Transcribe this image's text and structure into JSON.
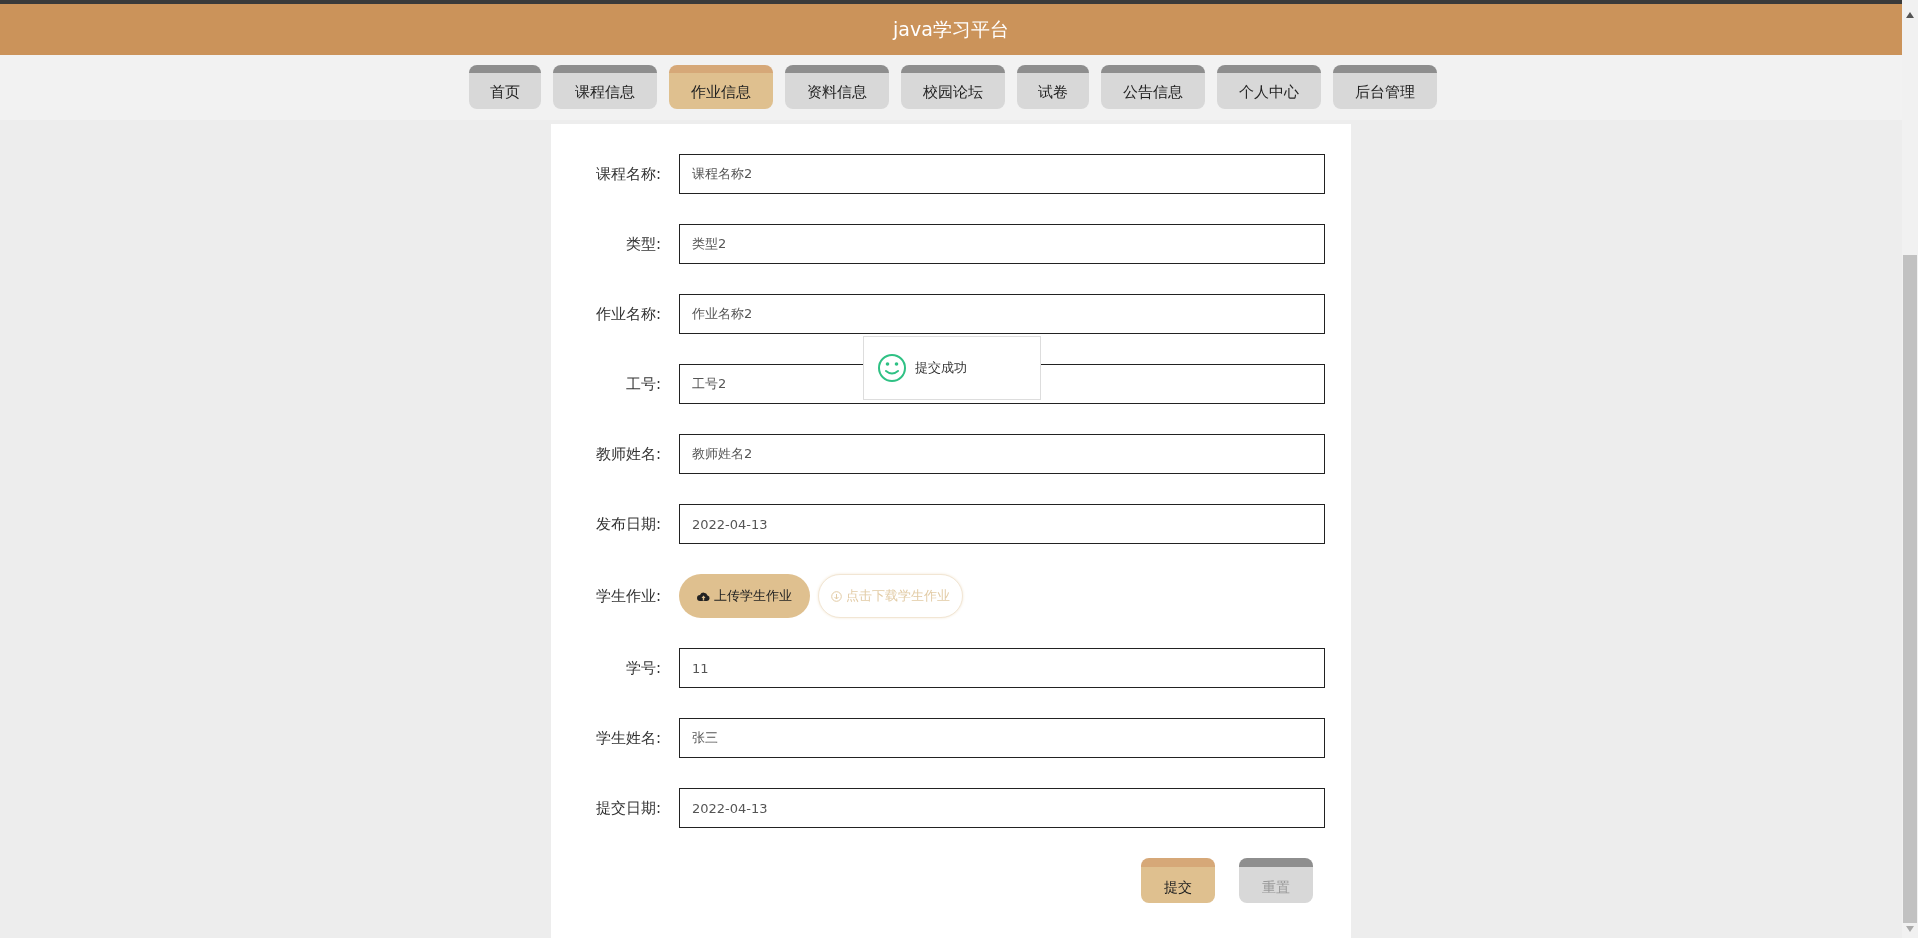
{
  "header": {
    "title": "java学习平台"
  },
  "nav": {
    "tabs": [
      {
        "label": "首页",
        "selected": false
      },
      {
        "label": "课程信息",
        "selected": false
      },
      {
        "label": "作业信息",
        "selected": true
      },
      {
        "label": "资料信息",
        "selected": false
      },
      {
        "label": "校园论坛",
        "selected": false
      },
      {
        "label": "试卷",
        "selected": false
      },
      {
        "label": "公告信息",
        "selected": false
      },
      {
        "label": "个人中心",
        "selected": false
      },
      {
        "label": "后台管理",
        "selected": false
      }
    ]
  },
  "form": {
    "fields": [
      {
        "kind": "text",
        "label": "课程名称:",
        "value": "课程名称2"
      },
      {
        "kind": "text",
        "label": "类型:",
        "value": "类型2"
      },
      {
        "kind": "text",
        "label": "作业名称:",
        "value": "作业名称2"
      },
      {
        "kind": "text",
        "label": "工号:",
        "value": "工号2"
      },
      {
        "kind": "text",
        "label": "教师姓名:",
        "value": "教师姓名2"
      },
      {
        "kind": "text",
        "label": "发布日期:",
        "value": "2022-04-13"
      },
      {
        "kind": "upload",
        "label": "学生作业:",
        "upload_button": "上传学生作业",
        "download_link": "点击下载学生作业"
      },
      {
        "kind": "text",
        "label": "学号:",
        "value": "11"
      },
      {
        "kind": "text",
        "label": "学生姓名:",
        "value": "张三"
      },
      {
        "kind": "text",
        "label": "提交日期:",
        "value": "2022-04-13"
      }
    ],
    "buttons": [
      {
        "kind": "primary",
        "label": "提交"
      },
      {
        "kind": "secondary",
        "label": "重置"
      }
    ]
  },
  "toast": {
    "message": "提交成功"
  }
}
